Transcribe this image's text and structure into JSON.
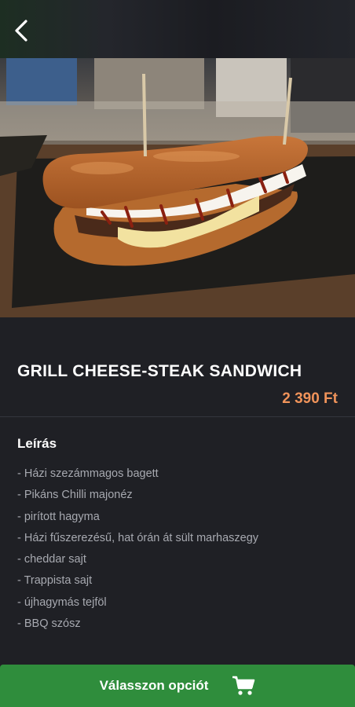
{
  "header": {
    "back_icon": "chevron-left-icon"
  },
  "product": {
    "name": "GRILL CHEESE-STEAK SANDWICH",
    "price": "2 390 Ft"
  },
  "description": {
    "heading": "Leírás",
    "items": [
      "- Házi szezámmagos bagett",
      "- Pikáns Chilli majonéz",
      "- pirított hagyma",
      "- Házi fűszerezésű, hat órán át sült marhaszegy",
      "- cheddar sajt",
      "- Trappista sajt",
      "- újhagymás tejföl",
      "- BBQ szósz"
    ]
  },
  "cta": {
    "label": "Válasszon opciót",
    "icon": "cart-icon"
  },
  "colors": {
    "accent_price": "#f0935a",
    "cta_green": "#2f8d3c",
    "background": "#1f2025"
  }
}
